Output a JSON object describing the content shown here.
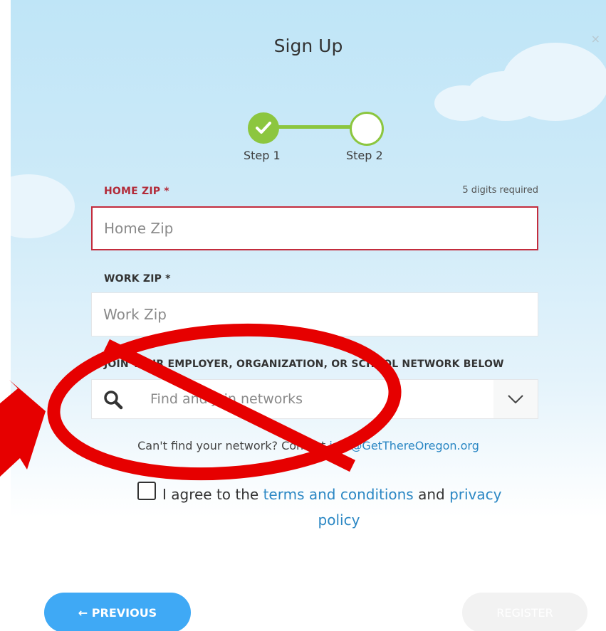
{
  "dialog": {
    "title": "Sign Up",
    "close_glyph": "×"
  },
  "steps": [
    {
      "label": "Step 1",
      "state": "complete"
    },
    {
      "label": "Step 2",
      "state": "current"
    }
  ],
  "home_zip": {
    "label": "HOME ZIP *",
    "hint": "5 digits required",
    "placeholder": "Home Zip",
    "value": ""
  },
  "work_zip": {
    "label": "WORK ZIP *",
    "placeholder": "Work Zip",
    "value": ""
  },
  "network": {
    "label": "JOIN YOUR EMPLOYER, ORGANIZATION, OR SCHOOL NETWORK BELOW",
    "placeholder": "Find and join networks"
  },
  "contact": {
    "text": "Can't find your network? Contact ",
    "email": "info@GetThereOregon.org"
  },
  "agree": {
    "prefix": "I agree to the ",
    "terms": "terms and conditions",
    "and": " and ",
    "privacy_part1": "privacy",
    "privacy_part2": "policy"
  },
  "buttons": {
    "previous": "← PREVIOUS",
    "register": "REGISTER"
  },
  "colors": {
    "accent_green": "#8cc63f",
    "primary_blue": "#3fa9f5",
    "error_red": "#c32c3d",
    "link_blue": "#2b87c4",
    "annotation_red": "#e60000"
  }
}
